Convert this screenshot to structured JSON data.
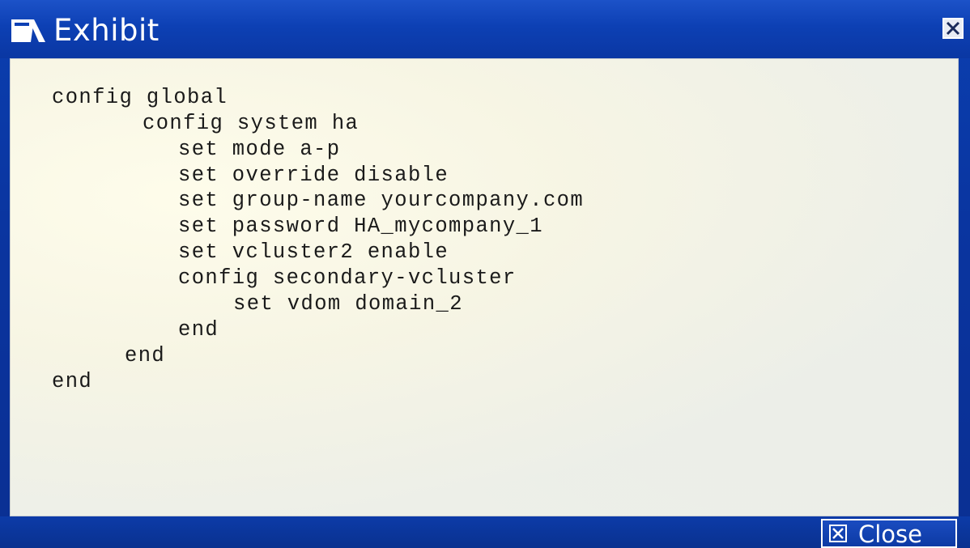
{
  "window": {
    "title": "Exhibit",
    "close_button_label": "Close"
  },
  "code_lines": [
    "config global",
    "config system ha",
    "set mode a-p",
    "set override disable",
    "set group-name yourcompany.com",
    "set password HA_mycompany_1",
    "set vcluster2 enable",
    "config secondary-vcluster",
    "set vdom domain_2",
    "end",
    "end",
    "end"
  ],
  "colors": {
    "titlebar": "#0d40b4",
    "content_background": "#eeeee4",
    "code_text": "#1a1a1a"
  },
  "icons": {
    "app": "exhibit-icon",
    "title_close": "close-icon",
    "close_button": "close-icon"
  }
}
